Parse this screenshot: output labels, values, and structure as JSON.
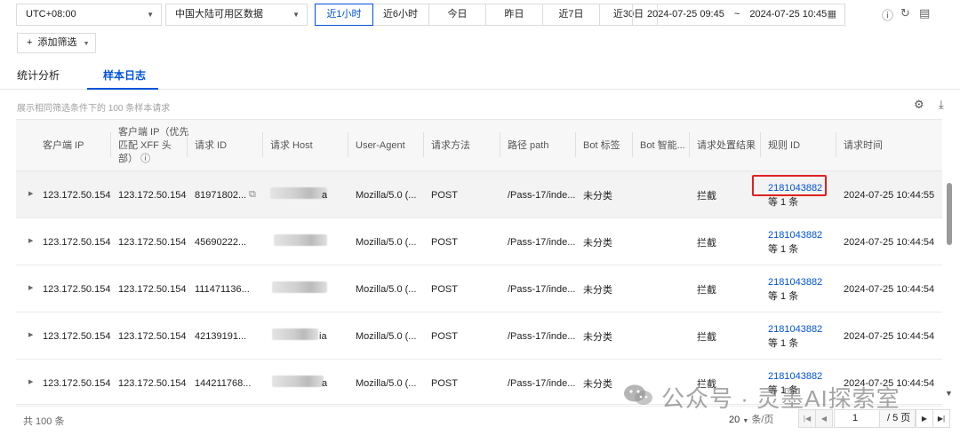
{
  "toolbar": {
    "timezone": "UTC+08:00",
    "region": "中国大陆可用区数据",
    "time_ranges": [
      "近1小时",
      "近6小时",
      "今日",
      "昨日",
      "近7日",
      "近30日"
    ],
    "active_range_index": 0,
    "date_start": "2024-07-25 09:45",
    "date_sep": "~",
    "date_end": "2024-07-25 10:45",
    "add_filter": "添加筛选"
  },
  "tabs": [
    {
      "label": "统计分析",
      "active": false
    },
    {
      "label": "样本日志",
      "active": true
    }
  ],
  "description": "展示相同筛选条件下的 100 条样本请求",
  "table": {
    "columns": [
      "客户端 IP",
      "客户端 IP（优先匹配 XFF 头部）",
      "请求 ID",
      "请求 Host",
      "User-Agent",
      "请求方法",
      "路径 path",
      "Bot 标签",
      "Bot 智能...",
      "请求处置结果",
      "规则 ID",
      "请求时间"
    ],
    "xff_header_lines": [
      "客户端 IP（优先",
      "匹配 XFF 头",
      "部）"
    ],
    "rows": [
      {
        "client_ip": "123.172.50.154",
        "xff_ip": "123.172.50.154",
        "request_id": "81971802...",
        "host_suffix": "a",
        "ua": "Mozilla/5.0 (...",
        "method": "POST",
        "path": "/Pass-17/inde...",
        "bot_tag": "未分类",
        "bot_smart": "",
        "result": "拦截",
        "rule_id": "2181043882",
        "rule_more": "等 1 条",
        "time": "2024-07-25 10:44:55"
      },
      {
        "client_ip": "123.172.50.154",
        "xff_ip": "123.172.50.154",
        "request_id": "45690222...",
        "host_suffix": "",
        "ua": "Mozilla/5.0 (...",
        "method": "POST",
        "path": "/Pass-17/inde...",
        "bot_tag": "未分类",
        "bot_smart": "",
        "result": "拦截",
        "rule_id": "2181043882",
        "rule_more": "等 1 条",
        "time": "2024-07-25 10:44:54"
      },
      {
        "client_ip": "123.172.50.154",
        "xff_ip": "123.172.50.154",
        "request_id": "111471136...",
        "host_suffix": "",
        "ua": "Mozilla/5.0 (...",
        "method": "POST",
        "path": "/Pass-17/inde...",
        "bot_tag": "未分类",
        "bot_smart": "",
        "result": "拦截",
        "rule_id": "2181043882",
        "rule_more": "等 1 条",
        "time": "2024-07-25 10:44:54"
      },
      {
        "client_ip": "123.172.50.154",
        "xff_ip": "123.172.50.154",
        "request_id": "42139191...",
        "host_suffix": "ia",
        "ua": "Mozilla/5.0 (...",
        "method": "POST",
        "path": "/Pass-17/inde...",
        "bot_tag": "未分类",
        "bot_smart": "",
        "result": "拦截",
        "rule_id": "2181043882",
        "rule_more": "等 1 条",
        "time": "2024-07-25 10:44:54"
      },
      {
        "client_ip": "123.172.50.154",
        "xff_ip": "123.172.50.154",
        "request_id": "144211768...",
        "host_suffix": "a",
        "ua": "Mozilla/5.0 (...",
        "method": "POST",
        "path": "/Pass-17/inde...",
        "bot_tag": "未分类",
        "bot_smart": "",
        "result": "拦截",
        "rule_id": "2181043882",
        "rule_more": "等 1 条",
        "time": "2024-07-25 10:44:54"
      }
    ]
  },
  "footer": {
    "total": "共 100 条",
    "page_size": "20",
    "page_size_unit": "条/页",
    "current_page": "1",
    "total_pages": "/ 5 页"
  },
  "watermark": "公众号 · 灵墨AI探索室",
  "colors": {
    "accent": "#0052d9",
    "highlight_box": "#e02020"
  }
}
